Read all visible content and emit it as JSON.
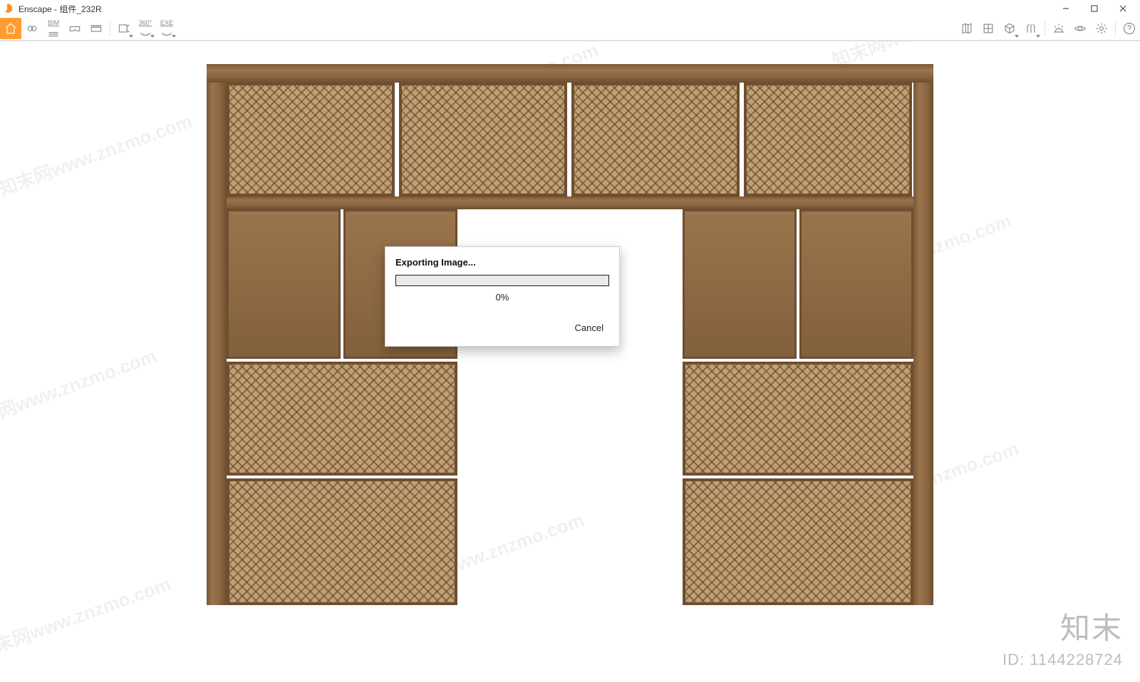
{
  "window": {
    "title": "Enscape - 组件_232R",
    "controls": {
      "min": "–",
      "max": "▢",
      "close": "✕"
    }
  },
  "toolbar": {
    "bim_label": "BIM",
    "threesixty_label": "360°",
    "exe_label": "EXE",
    "collapse_caret": "^"
  },
  "dialog": {
    "title": "Exporting Image...",
    "percent_text": "0%",
    "percent_value": 0,
    "cancel_label": "Cancel"
  },
  "watermark": {
    "diag_text": "知末网www.znzmo.com",
    "brand": "知末",
    "id_label": "ID: 1144228724"
  }
}
